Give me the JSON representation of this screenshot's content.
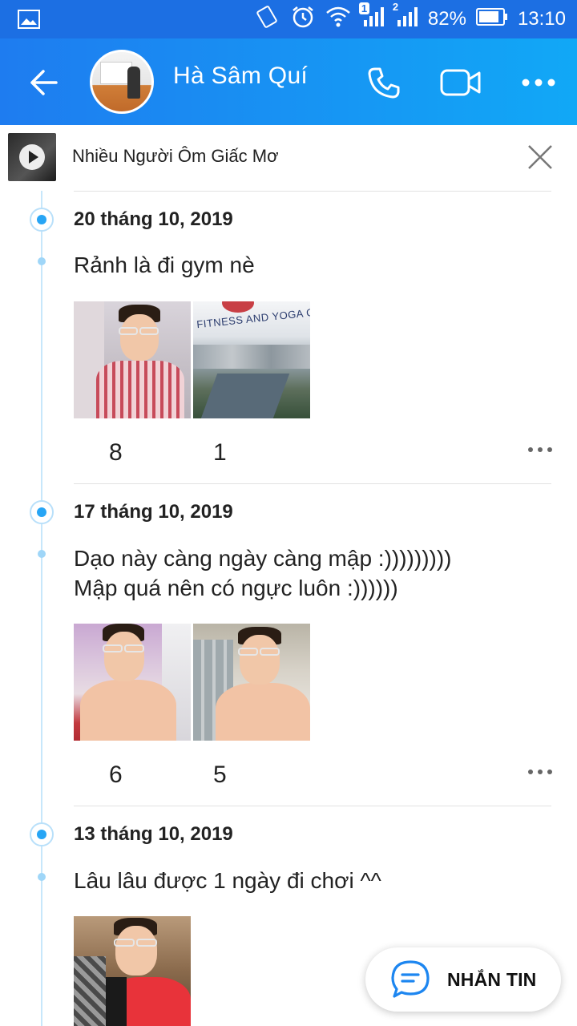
{
  "status_bar": {
    "notification_badge": "1",
    "sim_label": "2",
    "battery": "82%",
    "time": "13:10"
  },
  "header": {
    "name": "Hà Sâm Quí"
  },
  "music": {
    "title": "Nhiều Người Ôm Giấc Mơ"
  },
  "posts": [
    {
      "date": "20 tháng 10, 2019",
      "text_lines": [
        "Rảnh là đi gym nè"
      ],
      "likes": "8",
      "comments": "1",
      "photo_caption": "FITNESS AND YOGA CENTER"
    },
    {
      "date": "17 tháng 10, 2019",
      "text_lines": [
        "Dạo này càng ngày càng mập :)))))))))",
        "Mập quá nên có ngực luôn :))))))"
      ],
      "likes": "6",
      "comments": "5"
    },
    {
      "date": "13 tháng 10, 2019",
      "text_lines": [
        "Lâu lâu được 1 ngày đi chơi ^^"
      ]
    }
  ],
  "fab": {
    "label": "NHẮN TIN"
  },
  "colors": {
    "header_start": "#1e7cf0",
    "header_end": "#11a8f6",
    "timeline_dot": "#27a5f5"
  }
}
